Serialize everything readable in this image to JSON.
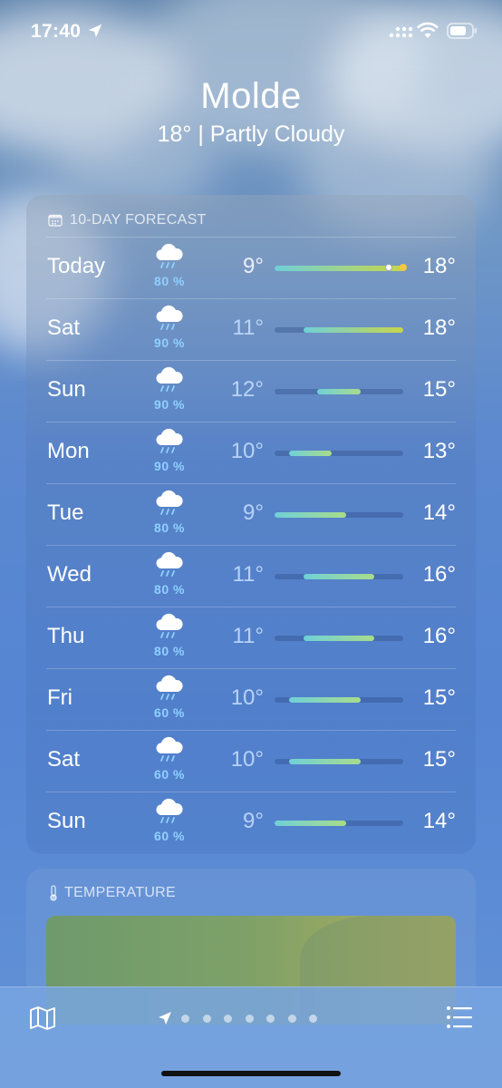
{
  "status_bar": {
    "time": "17:40"
  },
  "header": {
    "city": "Molde",
    "subtitle": "18°  |  Partly Cloudy"
  },
  "forecast": {
    "title": "10-DAY FORECAST",
    "range_min": 9,
    "range_max": 18,
    "days": [
      {
        "day": "Today",
        "precip": "80 %",
        "low": "9°",
        "high": "18°",
        "low_value": 9,
        "high_value": 18,
        "current_value": 17,
        "icon": "rain-cloud-icon"
      },
      {
        "day": "Sat",
        "precip": "90 %",
        "low": "11°",
        "high": "18°",
        "low_value": 11,
        "high_value": 18,
        "icon": "rain-cloud-icon"
      },
      {
        "day": "Sun",
        "precip": "90 %",
        "low": "12°",
        "high": "15°",
        "low_value": 12,
        "high_value": 15,
        "icon": "rain-cloud-icon"
      },
      {
        "day": "Mon",
        "precip": "90 %",
        "low": "10°",
        "high": "13°",
        "low_value": 10,
        "high_value": 13,
        "icon": "rain-cloud-icon"
      },
      {
        "day": "Tue",
        "precip": "80 %",
        "low": "9°",
        "high": "14°",
        "low_value": 9,
        "high_value": 14,
        "icon": "rain-cloud-icon"
      },
      {
        "day": "Wed",
        "precip": "80 %",
        "low": "11°",
        "high": "16°",
        "low_value": 11,
        "high_value": 16,
        "icon": "rain-cloud-icon"
      },
      {
        "day": "Thu",
        "precip": "80 %",
        "low": "11°",
        "high": "16°",
        "low_value": 11,
        "high_value": 16,
        "icon": "rain-cloud-icon"
      },
      {
        "day": "Fri",
        "precip": "60 %",
        "low": "10°",
        "high": "15°",
        "low_value": 10,
        "high_value": 15,
        "icon": "rain-cloud-icon"
      },
      {
        "day": "Sat",
        "precip": "60 %",
        "low": "10°",
        "high": "15°",
        "low_value": 10,
        "high_value": 15,
        "icon": "rain-cloud-icon"
      },
      {
        "day": "Sun",
        "precip": "60 %",
        "low": "9°",
        "high": "14°",
        "low_value": 9,
        "high_value": 14,
        "icon": "rain-cloud-icon"
      }
    ]
  },
  "temperature": {
    "title": "TEMPERATURE"
  },
  "bottom_bar": {
    "page_count": 7,
    "icons": [
      "map-icon",
      "location-arrow-icon",
      "list-icon"
    ]
  },
  "colors": {
    "precip": "#8fd0ff",
    "bar_cool": "#6fd0d8",
    "bar_warm": "#c7d64a",
    "accent_dot": "#f5c842"
  }
}
